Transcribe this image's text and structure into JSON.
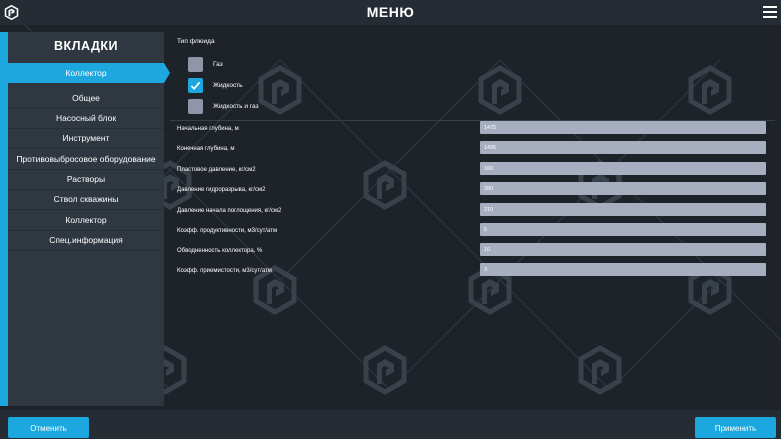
{
  "header": {
    "title": "МЕНЮ"
  },
  "sidebar": {
    "title": "ВКЛАДКИ",
    "active_tab": "Коллектор",
    "items": [
      {
        "label": "Общее"
      },
      {
        "label": "Насосный блок"
      },
      {
        "label": "Инструмент"
      },
      {
        "label": "Противовыбросовое оборудование"
      },
      {
        "label": "Растворы"
      },
      {
        "label": "Ствол скважины"
      },
      {
        "label": "Коллектор"
      },
      {
        "label": "Спец.информация"
      }
    ]
  },
  "form": {
    "fluid_type_label": "Тип флюида",
    "fluid_options": [
      {
        "label": "Газ",
        "checked": false
      },
      {
        "label": "Жидкость",
        "checked": true
      },
      {
        "label": "Жидкость и газ",
        "checked": false
      }
    ],
    "fields": [
      {
        "label": "Начальная глубина, м",
        "value": "1475"
      },
      {
        "label": "Конечная глубина, м",
        "value": "1495"
      },
      {
        "label": "Пластовое давление, кг/см2",
        "value": "160"
      },
      {
        "label": "Давление гидроразрыва, кг/см2",
        "value": "280"
      },
      {
        "label": "Давление начала поглощения, кг/см2",
        "value": "210"
      },
      {
        "label": "Коэфф. продуктивности, м3/сут/атм",
        "value": "5"
      },
      {
        "label": "Обводненность коллектора, %",
        "value": "10"
      },
      {
        "label": "Коэфф. приемистости, м3/сут/атм",
        "value": "3"
      }
    ]
  },
  "footer": {
    "cancel_label": "Отменить",
    "apply_label": "Применить"
  },
  "colors": {
    "accent": "#1ca7df",
    "background": "#1d2329",
    "panel": "#2f3740",
    "input": "#a6aec0"
  }
}
